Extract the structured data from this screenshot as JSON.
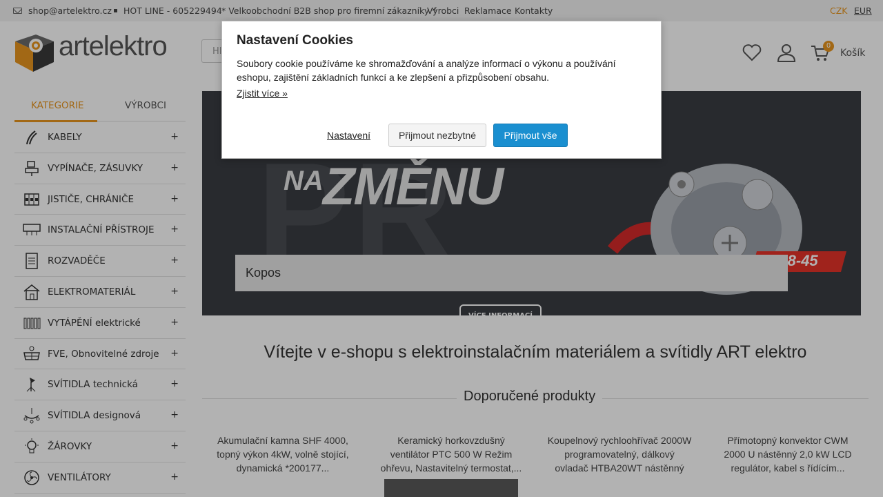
{
  "topbar": {
    "email": "shop@artelektro.cz",
    "hotline": "HOT LINE - 605229494",
    "b2b": "* Velkoobchodní B2B shop pro firemní zákazníky *",
    "links": [
      "Výrobci",
      "Reklamace",
      "Kontakty"
    ],
    "currencies": [
      "CZK",
      "EUR"
    ]
  },
  "header": {
    "logo_art": "art",
    "logo_elektro": "elektro",
    "search_placeholder": "Hl",
    "cart_count": "0",
    "cart_label": "Košík"
  },
  "sidebar": {
    "tabs": [
      "KATEGORIE",
      "VÝROBCI"
    ],
    "categories": [
      {
        "label": "KABELY",
        "icon": "cable-icon"
      },
      {
        "label": "VYPÍNAČE, ZÁSUVKY",
        "icon": "switch-icon"
      },
      {
        "label": "JISTIČE, CHRÁNIČE",
        "icon": "breaker-icon"
      },
      {
        "label": "INSTALAČNÍ PŘÍSTROJE",
        "icon": "device-icon"
      },
      {
        "label": "ROZVADĚČE",
        "icon": "distribution-board-icon"
      },
      {
        "label": "ELEKTROMATERIÁL",
        "icon": "house-icon"
      },
      {
        "label": "VYTÁPĚNÍ elektrické",
        "icon": "radiator-icon"
      },
      {
        "label": "FVE, Obnovitelné zdroje",
        "icon": "solar-panel-icon"
      },
      {
        "label": "SVÍTIDLA technická",
        "icon": "spotlight-icon"
      },
      {
        "label": "SVÍTIDLA designová",
        "icon": "chandelier-icon"
      },
      {
        "label": "ŽÁROVKY",
        "icon": "bulb-icon"
      },
      {
        "label": "VENTILÁTORY",
        "icon": "fan-icon"
      }
    ],
    "expand_symbol": "+"
  },
  "banner": {
    "bg_text": "PŘ",
    "headline_na": "NA",
    "headline_zmenu": "ZMĚNU",
    "tag": "68-45",
    "caption": "Kopos",
    "more_button": "VÍCE INFORMACÍ"
  },
  "main": {
    "welcome": "Vítejte v e-shopu s elektroinstalačním materiálem a svítidly ART elektro",
    "recommended_title": "Doporučené produkty",
    "products": [
      {
        "title": "Akumulační kamna SHF 4000, topný výkon 4kW, volně stojící, dynamická *200177..."
      },
      {
        "title": "Keramický horkovzdušný ventilátor PTC 500 W Režim ohřevu, Nastavitelný termostat,..."
      },
      {
        "title": "Koupelnový rychloohřívač 2000W programovatelný, dálkový ovladač HTBA20WT nástěnný"
      },
      {
        "title": "Přímotopný konvektor CWM 2000 U nástěnný 2,0 kW LCD regulátor, kabel s řídícím..."
      }
    ]
  },
  "cookie_modal": {
    "title": "Nastavení Cookies",
    "text": "Soubory cookie používáme ke shromažďování a analýze informací o výkonu a používání eshopu, zajištění základních funkcí a ke zlepšení a přizpůsobení obsahu.",
    "learn_more": "Zjistit více »",
    "settings_button": "Nastavení",
    "necessary_button": "Přijmout nezbytné",
    "accept_all_button": "Přijmout vše",
    "accent_color": "#1a8fd0"
  },
  "colors": {
    "brand_orange": "#e8961f",
    "overlay": "rgba(0,0,0,0.3)"
  }
}
